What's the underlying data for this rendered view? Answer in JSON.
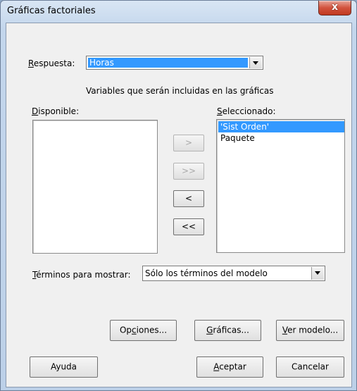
{
  "window": {
    "title": "Gráficas factoriales",
    "close_glyph": "x"
  },
  "respuesta": {
    "label_first": "R",
    "label_rest": "espuesta:",
    "value": "Horas"
  },
  "section_caption": "Variables que serán incluidas en las gráficas",
  "disponible": {
    "label_first": "D",
    "label_rest": "isponible:",
    "items": []
  },
  "seleccionado": {
    "label_first": "S",
    "label_rest": "eleccionado:",
    "items": [
      "'Sist Orden'",
      "Paquete"
    ]
  },
  "move_buttons": {
    "add_one": ">",
    "add_all": ">>",
    "remove_one": "<",
    "remove_all": "<<"
  },
  "terminos": {
    "label_first": "T",
    "label_rest": "érminos para mostrar:",
    "value": "Sólo los términos del modelo"
  },
  "buttons": {
    "opciones": {
      "pre": "Op",
      "mn": "c",
      "post": "iones..."
    },
    "graficas": {
      "pre": "",
      "mn": "G",
      "post": "ráficas..."
    },
    "ver_modelo": {
      "pre": "",
      "mn": "V",
      "post": "er modelo..."
    },
    "ayuda": "Ayuda",
    "aceptar": {
      "pre": "",
      "mn": "A",
      "post": "ceptar"
    },
    "cancelar": "Cancelar"
  },
  "colors": {
    "selection": "#3399ff",
    "dialog_bg": "#f0f0f0",
    "close_button": "#c8432b"
  }
}
